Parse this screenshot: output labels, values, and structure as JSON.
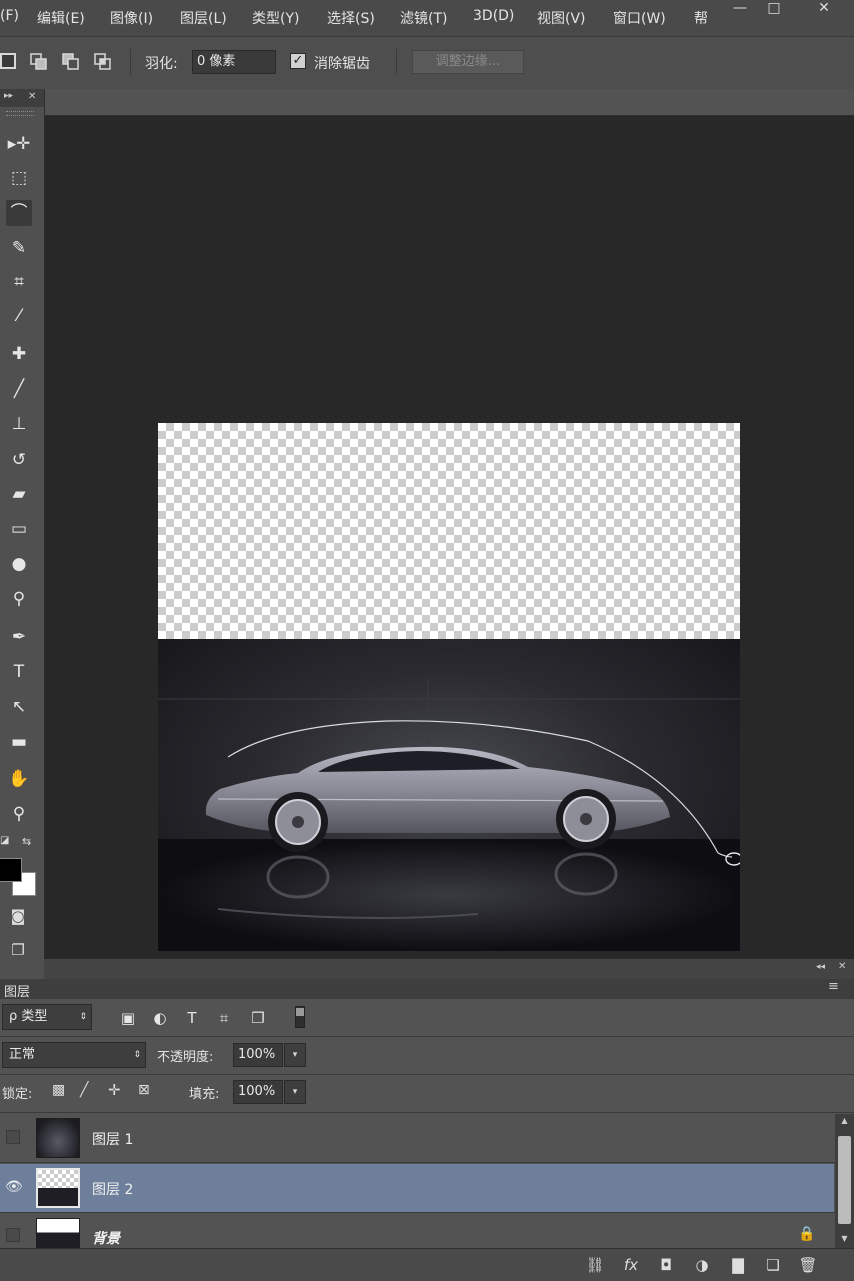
{
  "menu": {
    "items": [
      "(F)",
      "编辑(E)",
      "图像(I)",
      "图层(L)",
      "类型(Y)",
      "选择(S)",
      "滤镜(T)",
      "3D(D)",
      "视图(V)",
      "窗口(W)",
      "帮"
    ]
  },
  "window_controls": {
    "minimize": "—",
    "restore": "□",
    "close": "✕"
  },
  "options": {
    "feather_label": "羽化:",
    "feather_value": "0 像素",
    "antialias_label": "消除锯齿",
    "antialias_checked": true,
    "refine_edge_label": "调整边缘..."
  },
  "toolbar_header": {
    "collapse": "▸▸",
    "close": "✕"
  },
  "tools": [
    {
      "name": "move-tool-icon",
      "glyph": "▸✛"
    },
    {
      "name": "marquee-tool-icon",
      "glyph": "⬚"
    },
    {
      "name": "lasso-tool-icon",
      "glyph": "⌒",
      "active": true
    },
    {
      "name": "quick-selection-tool-icon",
      "glyph": "✎"
    },
    {
      "name": "crop-tool-icon",
      "glyph": "⌗"
    },
    {
      "name": "eyedropper-tool-icon",
      "glyph": "⁄"
    },
    {
      "name": "healing-brush-tool-icon",
      "glyph": "✚"
    },
    {
      "name": "brush-tool-icon",
      "glyph": "╱"
    },
    {
      "name": "clone-stamp-tool-icon",
      "glyph": "⊥"
    },
    {
      "name": "history-brush-tool-icon",
      "glyph": "↺"
    },
    {
      "name": "eraser-tool-icon",
      "glyph": "▰"
    },
    {
      "name": "gradient-tool-icon",
      "glyph": "▭"
    },
    {
      "name": "blur-tool-icon",
      "glyph": "●"
    },
    {
      "name": "dodge-tool-icon",
      "glyph": "⚲"
    },
    {
      "name": "pen-tool-icon",
      "glyph": "✒"
    },
    {
      "name": "type-tool-icon",
      "glyph": "T"
    },
    {
      "name": "path-selection-tool-icon",
      "glyph": "↖"
    },
    {
      "name": "rectangle-tool-icon",
      "glyph": "▬"
    },
    {
      "name": "hand-tool-icon",
      "glyph": "✋"
    },
    {
      "name": "zoom-tool-icon",
      "glyph": "⚲"
    }
  ],
  "colors": {
    "foreground": "#000000",
    "background": "#ffffff",
    "selected_layer": "#6e7f9b"
  },
  "layers_panel": {
    "title": "图层",
    "filter_label": "ρ 类型",
    "blend_mode": "正常",
    "opacity_label": "不透明度:",
    "opacity_value": "100%",
    "lock_label": "锁定:",
    "fill_label": "填充:",
    "fill_value": "100%",
    "layers": [
      {
        "name": "图层 1",
        "visible": false,
        "selected": false
      },
      {
        "name": "图层 2",
        "visible": true,
        "selected": true
      },
      {
        "name": "背景",
        "visible": false,
        "selected": false,
        "locked": true
      }
    ]
  },
  "panel_controls": {
    "collapse": "◂◂",
    "close": "✕",
    "menu": "≡"
  }
}
